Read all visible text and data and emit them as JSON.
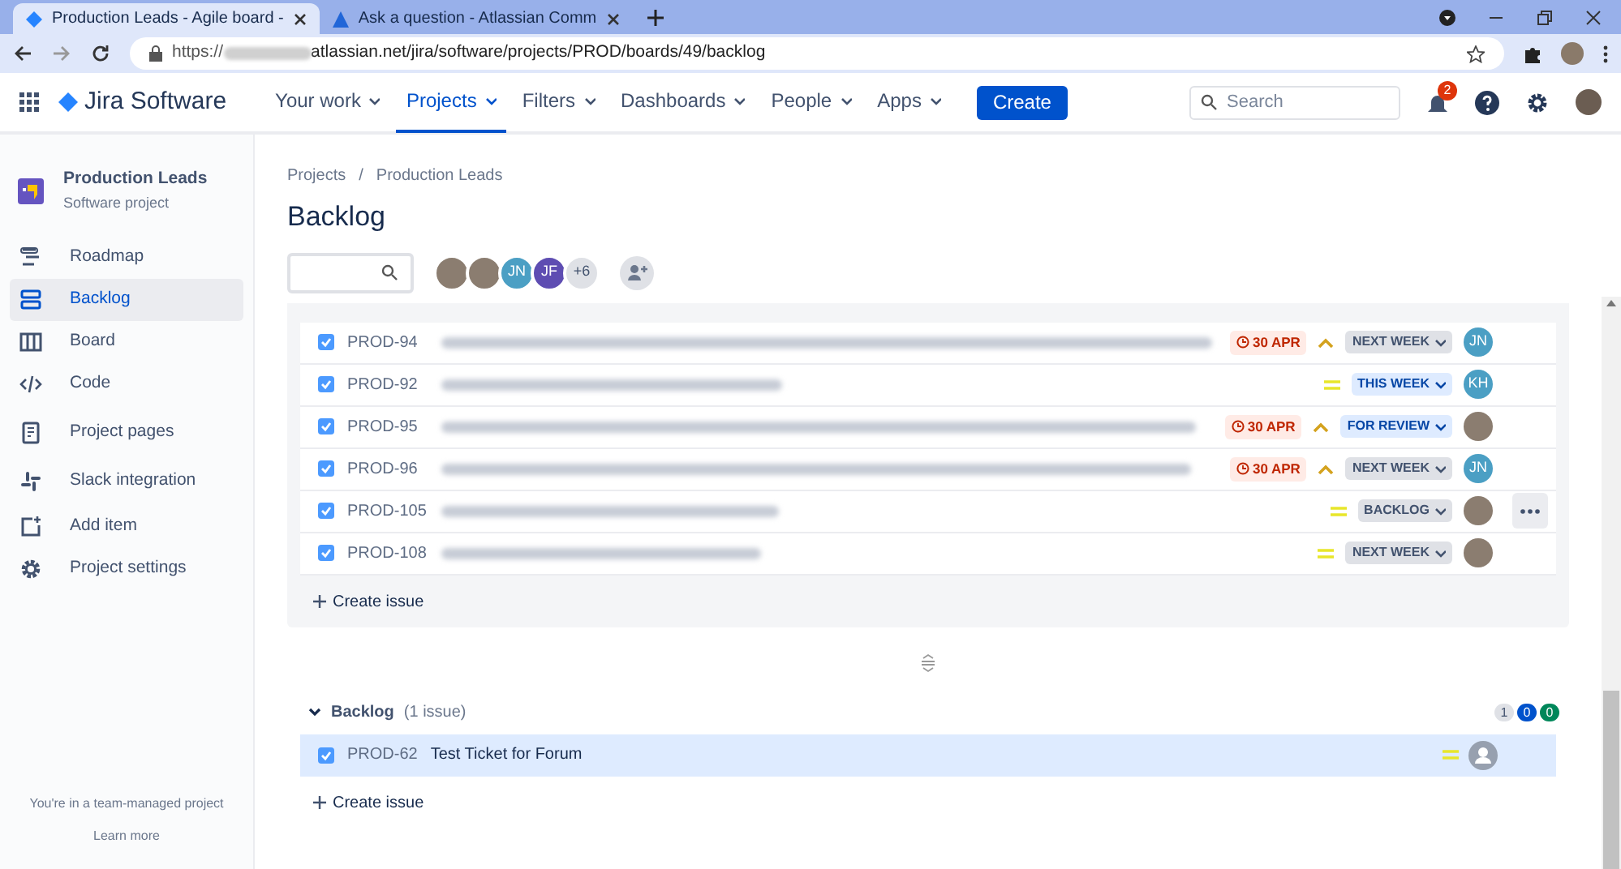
{
  "browser": {
    "tabs": [
      {
        "title": "Production Leads - Agile board -",
        "selected": true
      },
      {
        "title": "Ask a question - Atlassian Comm",
        "selected": false
      }
    ],
    "url_scheme": "https://",
    "url_rest": "atlassian.net/jira/software/projects/PROD/boards/49/backlog"
  },
  "nav": {
    "product": "Jira Software",
    "items": [
      {
        "label": "Your work",
        "selected": false
      },
      {
        "label": "Projects",
        "selected": true
      },
      {
        "label": "Filters",
        "selected": false
      },
      {
        "label": "Dashboards",
        "selected": false
      },
      {
        "label": "People",
        "selected": false
      },
      {
        "label": "Apps",
        "selected": false
      }
    ],
    "create": "Create",
    "search_placeholder": "Search",
    "notifications": "2"
  },
  "sidebar": {
    "project": "Production Leads",
    "project_type": "Software project",
    "items": [
      {
        "label": "Roadmap",
        "selected": false
      },
      {
        "label": "Backlog",
        "selected": true
      },
      {
        "label": "Board",
        "selected": false
      },
      {
        "label": "Code",
        "selected": false
      },
      {
        "label": "Project pages",
        "selected": false
      },
      {
        "label": "Slack integration",
        "selected": false
      },
      {
        "label": "Add item",
        "selected": false
      },
      {
        "label": "Project settings",
        "selected": false
      }
    ],
    "footer": "You're in a team-managed project",
    "footer_link": "Learn more"
  },
  "breadcrumbs": [
    {
      "label": "Projects"
    },
    {
      "separator": "/",
      "label": "Production Leads"
    }
  ],
  "title": "Backlog",
  "avatars": [
    {
      "kind": "photo"
    },
    {
      "kind": "photo"
    },
    {
      "kind": "initials",
      "text": "JN",
      "color": "#4b9fc4"
    },
    {
      "kind": "initials",
      "text": "JF",
      "color": "#5e4db2"
    },
    {
      "kind": "more",
      "text": "+6"
    }
  ],
  "sprint_issues": [
    {
      "key": "PROD-94",
      "checked": true,
      "due": "30 APR",
      "priority": {
        "kind": "high"
      },
      "status": {
        "text": "NEXT WEEK",
        "kind": "grey"
      },
      "assignee": {
        "kind": "initials",
        "text": "JN",
        "color": "#4b9fc4"
      },
      "menu": false
    },
    {
      "key": "PROD-92",
      "checked": true,
      "priority": {
        "kind": "medium"
      },
      "status": {
        "text": "THIS WEEK",
        "kind": "blue"
      },
      "assignee": {
        "kind": "initials",
        "text": "KH",
        "color": "#4b9fc4"
      },
      "menu": false
    },
    {
      "key": "PROD-95",
      "checked": true,
      "due": "30 APR",
      "priority": {
        "kind": "high"
      },
      "status": {
        "text": "FOR REVIEW",
        "kind": "blue"
      },
      "assignee": {
        "kind": "photo"
      },
      "menu": false
    },
    {
      "key": "PROD-96",
      "checked": true,
      "due": "30 APR",
      "priority": {
        "kind": "high"
      },
      "status": {
        "text": "NEXT WEEK",
        "kind": "grey"
      },
      "assignee": {
        "kind": "initials",
        "text": "JN",
        "color": "#4b9fc4"
      },
      "menu": false
    },
    {
      "key": "PROD-105",
      "checked": true,
      "priority": {
        "kind": "medium"
      },
      "status": {
        "text": "BACKLOG",
        "kind": "grey"
      },
      "assignee": {
        "kind": "photo"
      },
      "menu": true
    },
    {
      "key": "PROD-108",
      "checked": true,
      "priority": {
        "kind": "medium"
      },
      "status": {
        "text": "NEXT WEEK",
        "kind": "grey"
      },
      "assignee": {
        "kind": "photo"
      },
      "menu": false
    }
  ],
  "sprint_create": "Create issue",
  "backlog": {
    "title": "Backlog",
    "count": "(1 issue)",
    "expanded": true,
    "counters": [
      {
        "text": "1",
        "color": "#dfe1e6"
      },
      {
        "text": "0",
        "color": "#0052cc"
      },
      {
        "text": "0",
        "color": "#00875a"
      }
    ],
    "issues": [
      {
        "key": "PROD-62",
        "summary": "Test Ticket for Forum",
        "checked": true,
        "selected": true,
        "priority": {
          "kind": "medium"
        },
        "assignee": {
          "kind": "unassigned"
        }
      }
    ],
    "create": "Create issue"
  }
}
